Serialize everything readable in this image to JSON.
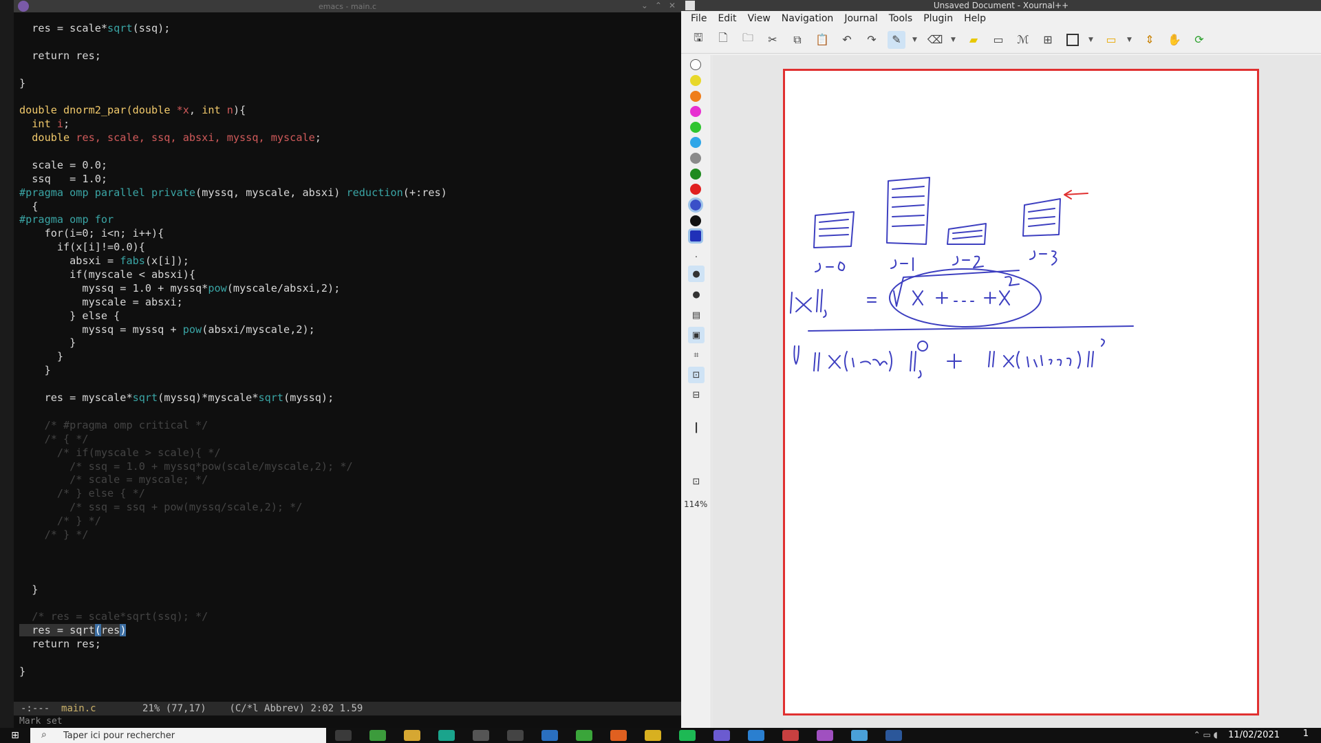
{
  "emacs": {
    "title": "emacs - main.c",
    "lines": [
      [
        {
          "t": "  res = scale*"
        },
        {
          "t": "sqrt",
          "c": "fn"
        },
        {
          "t": "(ssq);"
        }
      ],
      [
        {
          "t": ""
        }
      ],
      [
        {
          "t": "  return res;"
        }
      ],
      [
        {
          "t": ""
        }
      ],
      [
        {
          "t": "}"
        }
      ],
      [
        {
          "t": ""
        }
      ],
      [
        {
          "t": "double ",
          "c": "ty"
        },
        {
          "t": "dnorm2_par",
          "c": "kw"
        },
        {
          "t": "(double ",
          "c": "ty"
        },
        {
          "t": "*x",
          "c": "var"
        },
        {
          "t": ", "
        },
        {
          "t": "int ",
          "c": "ty"
        },
        {
          "t": "n",
          "c": "var"
        },
        {
          "t": "){"
        }
      ],
      [
        {
          "t": "  int ",
          "c": "ty"
        },
        {
          "t": "i",
          "c": "var"
        },
        {
          "t": ";"
        }
      ],
      [
        {
          "t": "  double ",
          "c": "ty"
        },
        {
          "t": "res, scale, ssq, absxi, myssq, myscale",
          "c": "var"
        },
        {
          "t": ";"
        }
      ],
      [
        {
          "t": ""
        }
      ],
      [
        {
          "t": "  scale = 0.0;"
        }
      ],
      [
        {
          "t": "  ssq   = 1.0;"
        }
      ],
      [
        {
          "t": "#pragma",
          "c": "pp"
        },
        {
          "t": " omp parallel ",
          "c": "pp"
        },
        {
          "t": "private",
          "c": "fn"
        },
        {
          "t": "(myssq, myscale, absxi) "
        },
        {
          "t": "reduction",
          "c": "fn"
        },
        {
          "t": "(+:res)"
        }
      ],
      [
        {
          "t": "  {"
        }
      ],
      [
        {
          "t": "#pragma",
          "c": "pp"
        },
        {
          "t": " omp for",
          "c": "pp"
        }
      ],
      [
        {
          "t": "    for(i=0; i<n; i++){"
        }
      ],
      [
        {
          "t": "      if(x[i]!=0.0){"
        }
      ],
      [
        {
          "t": "        absxi = "
        },
        {
          "t": "fabs",
          "c": "fn"
        },
        {
          "t": "(x[i]);"
        }
      ],
      [
        {
          "t": "        if(myscale < absxi){"
        }
      ],
      [
        {
          "t": "          myssq = 1.0 + myssq*"
        },
        {
          "t": "pow",
          "c": "fn"
        },
        {
          "t": "(myscale/absxi,2);"
        }
      ],
      [
        {
          "t": "          myscale = absxi;"
        }
      ],
      [
        {
          "t": "        } else {"
        }
      ],
      [
        {
          "t": "          myssq = myssq + "
        },
        {
          "t": "pow",
          "c": "fn"
        },
        {
          "t": "(absxi/myscale,2);"
        }
      ],
      [
        {
          "t": "        }"
        }
      ],
      [
        {
          "t": "      }"
        }
      ],
      [
        {
          "t": "    }"
        }
      ],
      [
        {
          "t": ""
        }
      ],
      [
        {
          "t": "    res = myscale*"
        },
        {
          "t": "sqrt",
          "c": "fn"
        },
        {
          "t": "(myssq)*myscale*"
        },
        {
          "t": "sqrt",
          "c": "fn"
        },
        {
          "t": "(myssq);"
        }
      ],
      [
        {
          "t": ""
        }
      ],
      [
        {
          "t": "    /* #pragma omp critical */",
          "c": "cm"
        }
      ],
      [
        {
          "t": "    /* { */",
          "c": "cm"
        }
      ],
      [
        {
          "t": "      /* if(myscale > scale){ */",
          "c": "cm"
        }
      ],
      [
        {
          "t": "        /* ssq = 1.0 + myssq*pow(scale/myscale,2); */",
          "c": "cm"
        }
      ],
      [
        {
          "t": "        /* scale = myscale; */",
          "c": "cm"
        }
      ],
      [
        {
          "t": "      /* } else { */",
          "c": "cm"
        }
      ],
      [
        {
          "t": "        /* ssq = ssq + pow(myssq/scale,2); */",
          "c": "cm"
        }
      ],
      [
        {
          "t": "      /* } */",
          "c": "cm"
        }
      ],
      [
        {
          "t": "    /* } */",
          "c": "cm"
        }
      ],
      [
        {
          "t": ""
        }
      ],
      [
        {
          "t": ""
        }
      ],
      [
        {
          "t": ""
        }
      ],
      [
        {
          "t": "  }"
        }
      ],
      [
        {
          "t": ""
        }
      ],
      [
        {
          "t": "  /* res = scale*sqrt(ssq); */",
          "c": "cm"
        }
      ],
      [
        {
          "t": "  res = sqrt",
          "c": "hl-region"
        },
        {
          "t": "(",
          "c": "cursor"
        },
        {
          "t": "res",
          "c": "hl-region"
        },
        {
          "t": ")",
          "c": "cursor"
        }
      ],
      [
        {
          "t": "  return res;"
        }
      ],
      [
        {
          "t": ""
        }
      ],
      [
        {
          "t": "}"
        }
      ]
    ],
    "mode_line": {
      "flags": "-:---  ",
      "buffer": "main.c",
      "position": "        21% (77,17)    (C/*l Abbrev) 2:02 1.59"
    },
    "minibuffer": "Mark set"
  },
  "xournal": {
    "title": "Unsaved Document - Xournal++",
    "menu": [
      "File",
      "Edit",
      "View",
      "Navigation",
      "Journal",
      "Tools",
      "Plugin",
      "Help"
    ],
    "zoom": "114%",
    "pen_colors": [
      "#ffffff",
      "#e8d82a",
      "#ef7d1a",
      "#e72fd0",
      "#2fc42f",
      "#2fa6e8",
      "#8a8a8a",
      "#1e8a1e",
      "#e02020",
      "#3a4fc8",
      "#111111",
      "#2030b8"
    ],
    "handwriting": {
      "labels": [
        "j=0",
        "j=1",
        "j=2",
        "j=3"
      ],
      "formula_1": "||x||₂ = √(x₁² + ... + xₙ²)",
      "formula_2": "||x(1:100)||₂² + ||x(101:200)||²"
    }
  },
  "taskbar": {
    "search_placeholder": "Taper ici pour rechercher",
    "date": "11/02/2021",
    "notifications": "1"
  }
}
